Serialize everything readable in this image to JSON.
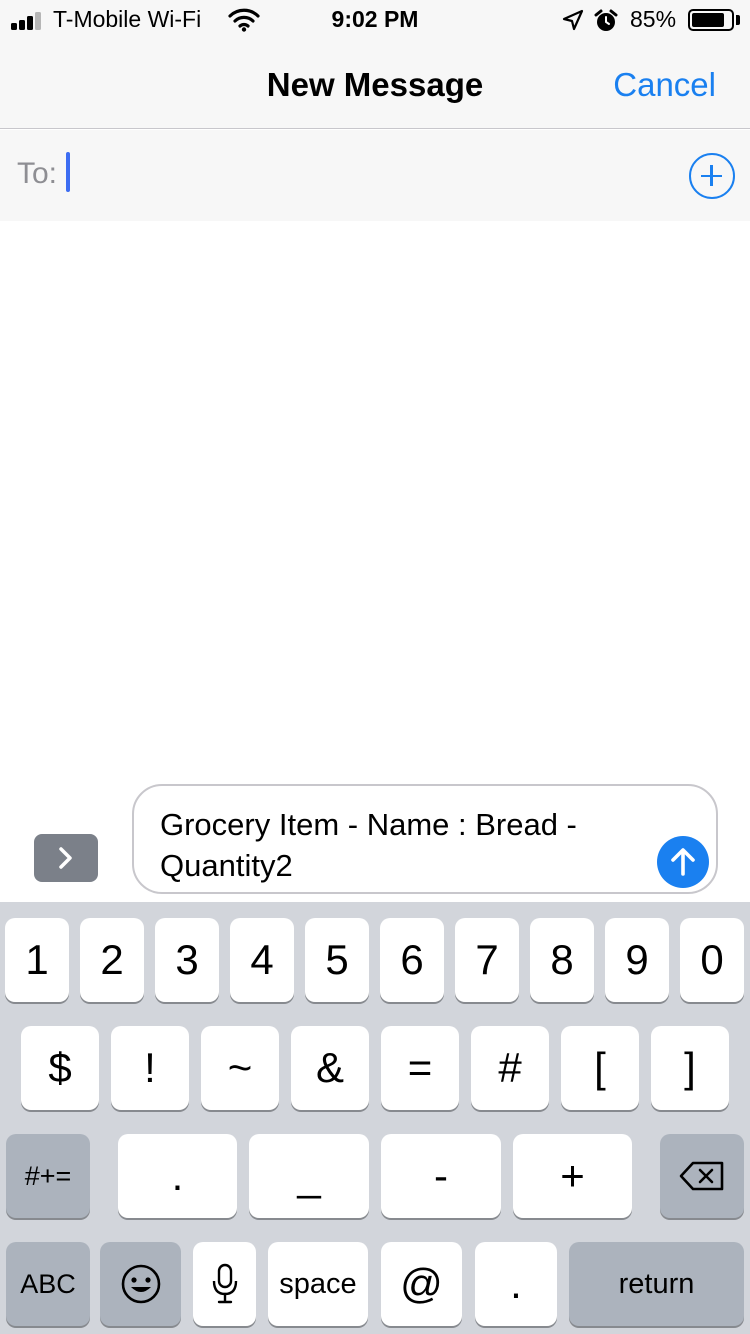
{
  "status": {
    "carrier": "T-Mobile Wi-Fi",
    "time": "9:02 PM",
    "battery_percent": "85%",
    "battery_level": 0.85,
    "signal_bars": 3
  },
  "nav": {
    "title": "New Message",
    "cancel_label": "Cancel"
  },
  "recipient": {
    "to_label": "To:",
    "value": ""
  },
  "compose": {
    "message_text": "Grocery Item - Name : Bread - Quantity2"
  },
  "keyboard": {
    "row1": [
      "1",
      "2",
      "3",
      "4",
      "5",
      "6",
      "7",
      "8",
      "9",
      "0"
    ],
    "row2": [
      "$",
      "!",
      "~",
      "&",
      "=",
      "#",
      "[",
      "]"
    ],
    "row3": [
      ".",
      "_",
      "-",
      "+"
    ],
    "symbols_toggle": "#+=",
    "abc_label": "ABC",
    "space_label": "space",
    "at_key": "@",
    "period_key": ".",
    "return_label": "return"
  },
  "colors": {
    "accent": "#1a80f0",
    "bar_background": "#f7f7f7",
    "keyboard_background": "#d2d5db",
    "special_key": "#acb3bd"
  }
}
